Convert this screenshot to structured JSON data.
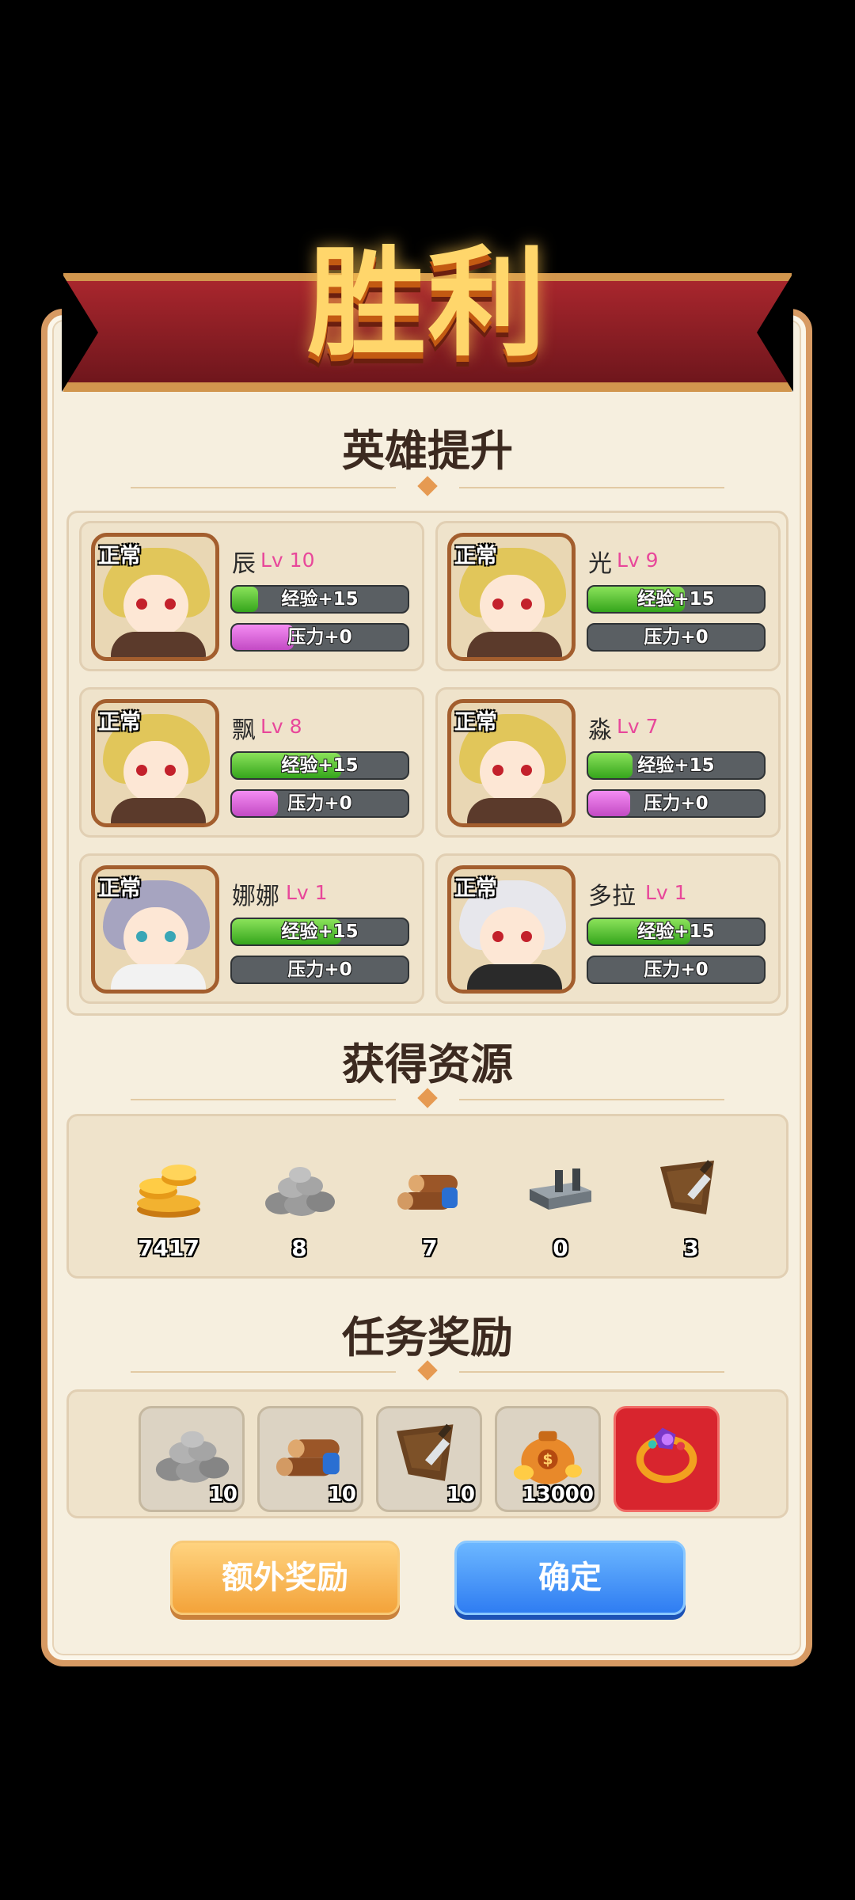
{
  "victory_title": "胜利",
  "sections": {
    "hero_upgrade": "英雄提升",
    "resources_obtained": "获得资源",
    "mission_rewards": "任务奖励"
  },
  "heroes": [
    {
      "status": "正常",
      "name": "辰",
      "level": "Lv 10",
      "exp": "经验+15",
      "exp_fill": 0.15,
      "stress": "压力+0",
      "stress_fill": 0.35,
      "hair_color": "#e1c65a",
      "eye_color": "#c3212b",
      "outfit_color": "#5b3a2b"
    },
    {
      "status": "正常",
      "name": "光",
      "level": "Lv 9",
      "exp": "经验+15",
      "exp_fill": 0.55,
      "stress": "压力+0",
      "stress_fill": 0.0,
      "hair_color": "#e1c65a",
      "eye_color": "#c3212b",
      "outfit_color": "#5b3a2b"
    },
    {
      "status": "正常",
      "name": "飘",
      "level": "Lv 8",
      "exp": "经验+15",
      "exp_fill": 0.62,
      "stress": "压力+0",
      "stress_fill": 0.26,
      "hair_color": "#e1c65a",
      "eye_color": "#c3212b",
      "outfit_color": "#5b3a2b"
    },
    {
      "status": "正常",
      "name": "淼",
      "level": "Lv 7",
      "exp": "经验+15",
      "exp_fill": 0.25,
      "stress": "压力+0",
      "stress_fill": 0.24,
      "hair_color": "#e1c65a",
      "eye_color": "#c3212b",
      "outfit_color": "#5b3a2b"
    },
    {
      "status": "正常",
      "name": "娜娜",
      "level": "Lv 1",
      "exp": "经验+15",
      "exp_fill": 0.62,
      "stress": "压力+0",
      "stress_fill": 0.0,
      "hair_color": "#a6a4c0",
      "eye_color": "#39a6b6",
      "outfit_color": "#f2f2f2"
    },
    {
      "status": "正常",
      "name": "多拉",
      "level": "Lv 1",
      "exp": "经验+15",
      "exp_fill": 0.58,
      "stress": "压力+0",
      "stress_fill": 0.0,
      "hair_color": "#e7e7ec",
      "eye_color": "#c3212b",
      "outfit_color": "#2a2a2a"
    }
  ],
  "resources": [
    {
      "icon": "gold-coins-icon",
      "count": "7417"
    },
    {
      "icon": "stone-icon",
      "count": "8"
    },
    {
      "icon": "wood-logs-icon",
      "count": "7"
    },
    {
      "icon": "iron-ingot-icon",
      "count": "0"
    },
    {
      "icon": "leather-icon",
      "count": "3"
    }
  ],
  "rewards": [
    {
      "icon": "stone-icon",
      "count": "10"
    },
    {
      "icon": "wood-logs-icon",
      "count": "10"
    },
    {
      "icon": "leather-icon",
      "count": "10"
    },
    {
      "icon": "money-bag-icon",
      "count": "13000"
    },
    {
      "icon": "gem-ring-icon",
      "count": ""
    }
  ],
  "buttons": {
    "extra_reward": "额外奖励",
    "confirm": "确定"
  }
}
